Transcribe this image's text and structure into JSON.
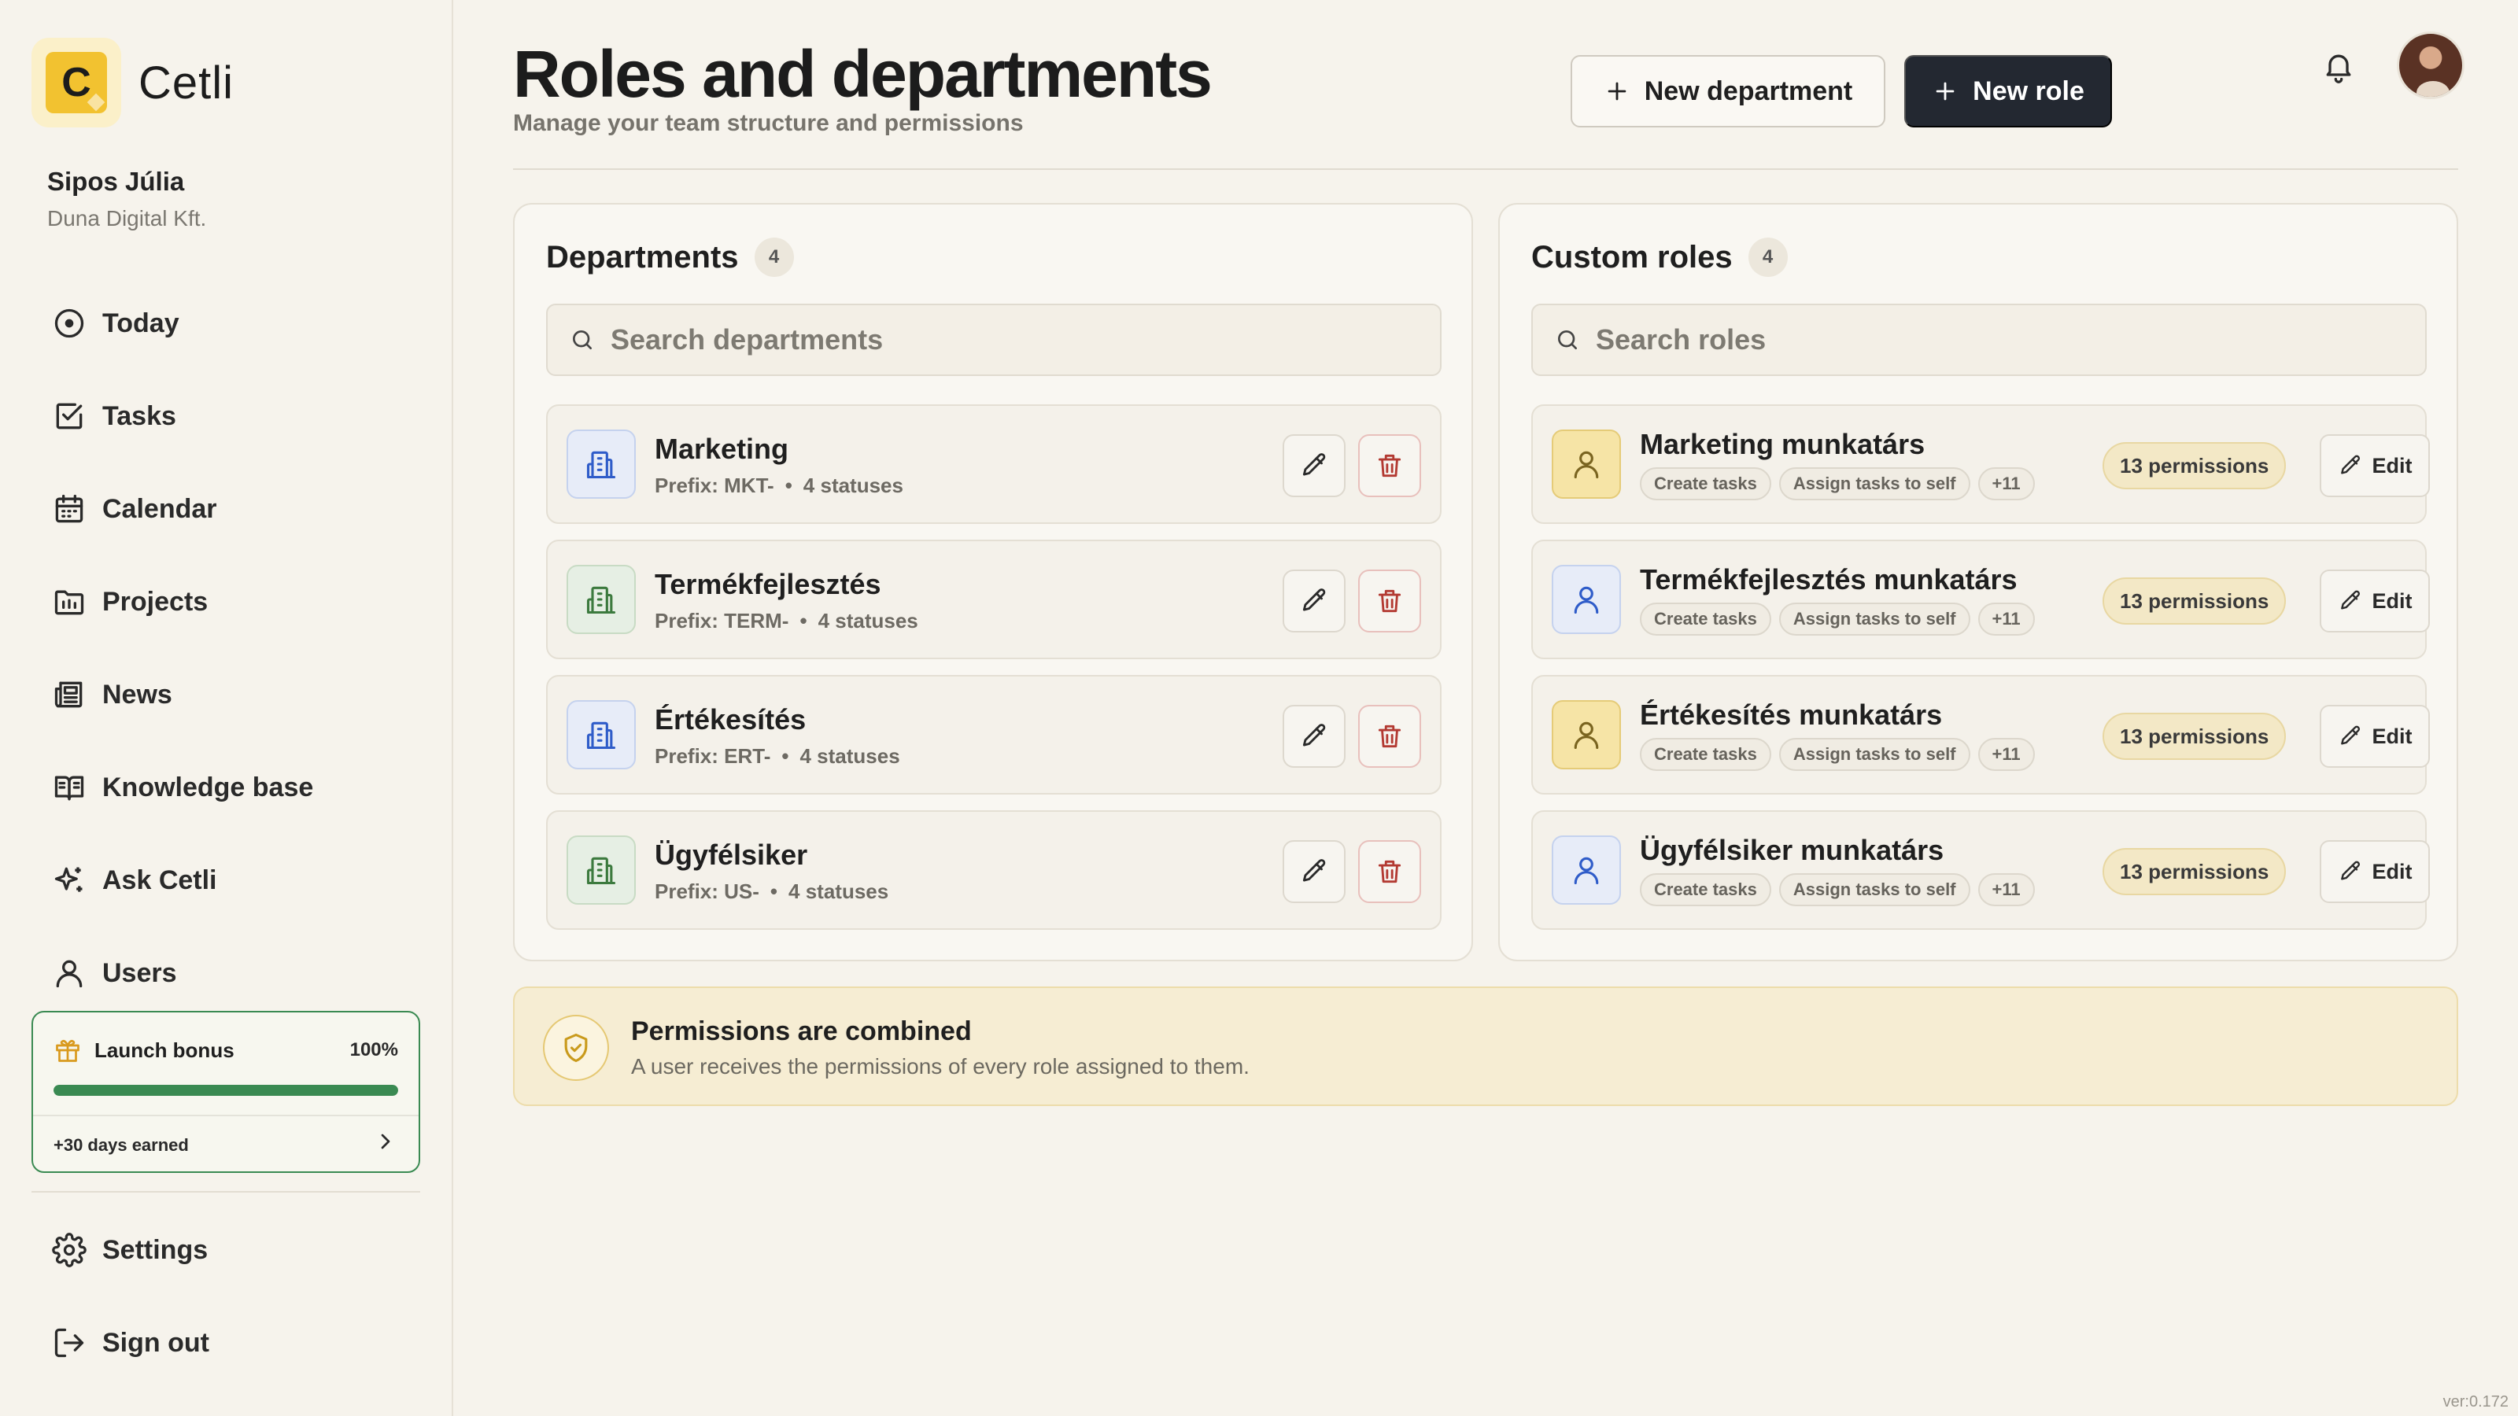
{
  "app": {
    "name": "Cetli",
    "logo_letter": "C"
  },
  "user": {
    "name": "Sipos Júlia",
    "org": "Duna Digital Kft."
  },
  "sidebar": {
    "items": [
      {
        "label": "Today",
        "icon": "clock-icon"
      },
      {
        "label": "Tasks",
        "icon": "checkbox-icon"
      },
      {
        "label": "Calendar",
        "icon": "calendar-icon"
      },
      {
        "label": "Projects",
        "icon": "folder-icon"
      },
      {
        "label": "News",
        "icon": "newspaper-icon"
      },
      {
        "label": "Knowledge base",
        "icon": "book-icon"
      },
      {
        "label": "Ask Cetli",
        "icon": "sparkles-icon"
      },
      {
        "label": "Users",
        "icon": "user-icon"
      }
    ],
    "bonus": {
      "title": "Launch bonus",
      "percent_label": "100%",
      "progress": 1.0,
      "earned": "+30 days earned"
    },
    "bottom_items": [
      {
        "label": "Settings",
        "icon": "gear-icon"
      },
      {
        "label": "Sign out",
        "icon": "sign-out-icon"
      }
    ]
  },
  "header": {
    "title": "Roles and departments",
    "subtitle": "Manage your team structure and permissions",
    "new_department_label": "New department",
    "new_role_label": "New role"
  },
  "departments": {
    "title": "Departments",
    "count": "4",
    "search_placeholder": "Search departments",
    "items": [
      {
        "name": "Marketing",
        "prefix": "Prefix: MKT-",
        "statuses": "4 statuses",
        "color": "blue"
      },
      {
        "name": "Termékfejlesztés",
        "prefix": "Prefix: TERM-",
        "statuses": "4 statuses",
        "color": "green"
      },
      {
        "name": "Értékesítés",
        "prefix": "Prefix: ERT-",
        "statuses": "4 statuses",
        "color": "blue"
      },
      {
        "name": "Ügyfélsiker",
        "prefix": "Prefix: US-",
        "statuses": "4 statuses",
        "color": "green"
      }
    ]
  },
  "roles": {
    "title": "Custom roles",
    "count": "4",
    "search_placeholder": "Search roles",
    "edit_label": "Edit",
    "items": [
      {
        "name": "Marketing munkatárs",
        "chips": [
          "Create tasks",
          "Assign tasks to self",
          "+11"
        ],
        "permissions": "13 permissions",
        "color": "yellow"
      },
      {
        "name": "Termékfejlesztés munkatárs",
        "chips": [
          "Create tasks",
          "Assign tasks to self",
          "+11"
        ],
        "permissions": "13 permissions",
        "color": "blue"
      },
      {
        "name": "Értékesítés munkatárs",
        "chips": [
          "Create tasks",
          "Assign tasks to self",
          "+11"
        ],
        "permissions": "13 permissions",
        "color": "yellow"
      },
      {
        "name": "Ügyfélsiker munkatárs",
        "chips": [
          "Create tasks",
          "Assign tasks to self",
          "+11"
        ],
        "permissions": "13 permissions",
        "color": "blue"
      }
    ]
  },
  "info": {
    "title": "Permissions are combined",
    "text": "A user receives the permissions of every role assigned to them."
  },
  "version": "ver:0.172",
  "colors": {
    "accent_dark": "#232831",
    "bonus_green": "#3a8a52",
    "brand_yellow": "#f2c230",
    "danger": "#b33a32"
  }
}
